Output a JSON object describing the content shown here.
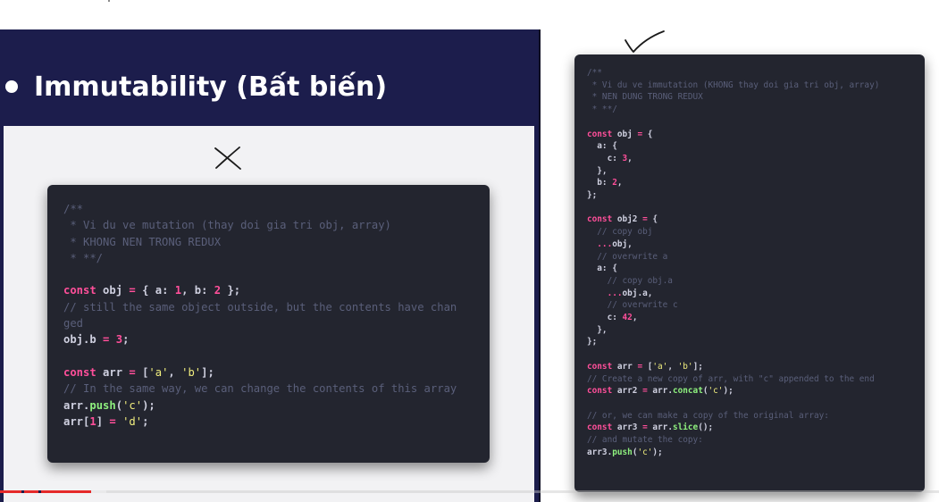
{
  "slide": {
    "heading": "Immutability (Bất biến)"
  },
  "left_code": {
    "lines": [
      [
        {
          "t": "c",
          "v": "/**"
        }
      ],
      [
        {
          "t": "c",
          "v": " * Vi du ve mutation (thay doi gia tri obj, array)"
        }
      ],
      [
        {
          "t": "c",
          "v": " * KHONG NEN TRONG REDUX"
        }
      ],
      [
        {
          "t": "c",
          "v": " * **/"
        }
      ],
      [],
      [
        {
          "t": "k",
          "v": "const "
        },
        {
          "t": "p",
          "v": "obj"
        },
        {
          "t": "k",
          "v": " = "
        },
        {
          "t": "p",
          "v": "{ a: "
        },
        {
          "t": "n",
          "v": "1"
        },
        {
          "t": "p",
          "v": ", b: "
        },
        {
          "t": "n",
          "v": "2"
        },
        {
          "t": "p",
          "v": " };"
        }
      ],
      [
        {
          "t": "c",
          "v": "// still the same object outside, but the contents have chan"
        }
      ],
      [
        {
          "t": "c",
          "v": "ged"
        }
      ],
      [
        {
          "t": "p",
          "v": "obj.b "
        },
        {
          "t": "k",
          "v": "= "
        },
        {
          "t": "n",
          "v": "3"
        },
        {
          "t": "p",
          "v": ";"
        }
      ],
      [],
      [
        {
          "t": "k",
          "v": "const "
        },
        {
          "t": "p",
          "v": "arr"
        },
        {
          "t": "k",
          "v": " = "
        },
        {
          "t": "p",
          "v": "["
        },
        {
          "t": "s",
          "v": "'a'"
        },
        {
          "t": "p",
          "v": ", "
        },
        {
          "t": "s",
          "v": "'b'"
        },
        {
          "t": "p",
          "v": "];"
        }
      ],
      [
        {
          "t": "c",
          "v": "// In the same way, we can change the contents of this array"
        }
      ],
      [
        {
          "t": "p",
          "v": "arr."
        },
        {
          "t": "f",
          "v": "push"
        },
        {
          "t": "p",
          "v": "("
        },
        {
          "t": "s",
          "v": "'c'"
        },
        {
          "t": "p",
          "v": ");"
        }
      ],
      [
        {
          "t": "p",
          "v": "arr["
        },
        {
          "t": "n",
          "v": "1"
        },
        {
          "t": "p",
          "v": "] "
        },
        {
          "t": "k",
          "v": "= "
        },
        {
          "t": "s",
          "v": "'d'"
        },
        {
          "t": "p",
          "v": ";"
        }
      ]
    ]
  },
  "right_code": {
    "lines": [
      [
        {
          "t": "c",
          "v": "/**"
        }
      ],
      [
        {
          "t": "c",
          "v": " * Vi du ve immutation (KHONG thay doi gia tri obj, array)"
        }
      ],
      [
        {
          "t": "c",
          "v": " * NEN DUNG TRONG REDUX"
        }
      ],
      [
        {
          "t": "c",
          "v": " * **/"
        }
      ],
      [],
      [
        {
          "t": "k",
          "v": "const "
        },
        {
          "t": "p",
          "v": "obj"
        },
        {
          "t": "k",
          "v": " = "
        },
        {
          "t": "p",
          "v": "{"
        }
      ],
      [
        {
          "t": "p",
          "v": "  a: {"
        }
      ],
      [
        {
          "t": "p",
          "v": "    c: "
        },
        {
          "t": "n",
          "v": "3"
        },
        {
          "t": "p",
          "v": ","
        }
      ],
      [
        {
          "t": "p",
          "v": "  },"
        }
      ],
      [
        {
          "t": "p",
          "v": "  b: "
        },
        {
          "t": "n",
          "v": "2"
        },
        {
          "t": "p",
          "v": ","
        }
      ],
      [
        {
          "t": "p",
          "v": "};"
        }
      ],
      [],
      [
        {
          "t": "k",
          "v": "const "
        },
        {
          "t": "p",
          "v": "obj2"
        },
        {
          "t": "k",
          "v": " = "
        },
        {
          "t": "p",
          "v": "{"
        }
      ],
      [
        {
          "t": "c",
          "v": "  // copy obj"
        }
      ],
      [
        {
          "t": "k",
          "v": "  ..."
        },
        {
          "t": "p",
          "v": "obj,"
        }
      ],
      [
        {
          "t": "c",
          "v": "  // overwrite a"
        }
      ],
      [
        {
          "t": "p",
          "v": "  a: {"
        }
      ],
      [
        {
          "t": "c",
          "v": "    // copy obj.a"
        }
      ],
      [
        {
          "t": "k",
          "v": "    ..."
        },
        {
          "t": "p",
          "v": "obj.a,"
        }
      ],
      [
        {
          "t": "c",
          "v": "    // overwrite c"
        }
      ],
      [
        {
          "t": "p",
          "v": "    c: "
        },
        {
          "t": "n",
          "v": "42"
        },
        {
          "t": "p",
          "v": ","
        }
      ],
      [
        {
          "t": "p",
          "v": "  },"
        }
      ],
      [
        {
          "t": "p",
          "v": "};"
        }
      ],
      [],
      [
        {
          "t": "k",
          "v": "const "
        },
        {
          "t": "p",
          "v": "arr"
        },
        {
          "t": "k",
          "v": " = "
        },
        {
          "t": "p",
          "v": "["
        },
        {
          "t": "s",
          "v": "'a'"
        },
        {
          "t": "p",
          "v": ", "
        },
        {
          "t": "s",
          "v": "'b'"
        },
        {
          "t": "p",
          "v": "];"
        }
      ],
      [
        {
          "t": "c",
          "v": "// Create a new copy of arr, with \"c\" appended to the end"
        }
      ],
      [
        {
          "t": "k",
          "v": "const "
        },
        {
          "t": "p",
          "v": "arr2"
        },
        {
          "t": "k",
          "v": " = "
        },
        {
          "t": "p",
          "v": "arr."
        },
        {
          "t": "f",
          "v": "concat"
        },
        {
          "t": "p",
          "v": "("
        },
        {
          "t": "s",
          "v": "'c'"
        },
        {
          "t": "p",
          "v": ");"
        }
      ],
      [],
      [
        {
          "t": "c",
          "v": "// or, we can make a copy of the original array:"
        }
      ],
      [
        {
          "t": "k",
          "v": "const "
        },
        {
          "t": "p",
          "v": "arr3"
        },
        {
          "t": "k",
          "v": " = "
        },
        {
          "t": "p",
          "v": "arr."
        },
        {
          "t": "f",
          "v": "slice"
        },
        {
          "t": "p",
          "v": "();"
        }
      ],
      [
        {
          "t": "c",
          "v": "// and mutate the copy:"
        }
      ],
      [
        {
          "t": "p",
          "v": "arr3."
        },
        {
          "t": "f",
          "v": "push"
        },
        {
          "t": "p",
          "v": "("
        },
        {
          "t": "s",
          "v": "'c'"
        },
        {
          "t": "p",
          "v": ");"
        }
      ]
    ]
  },
  "annotations": {
    "left_mark": "cross-mark",
    "right_mark": "check-mark"
  },
  "player": {
    "progress_fraction": 0.097,
    "buffered_fraction": 0.113
  },
  "colors": {
    "slide_bg": "#1c1d4c",
    "card_bg": "#23252f",
    "comment": "#5a5f7a",
    "keyword": "#ff4f9a",
    "string": "#f1ee7e",
    "function": "#8ef07e",
    "progress": "#e52a2a"
  }
}
